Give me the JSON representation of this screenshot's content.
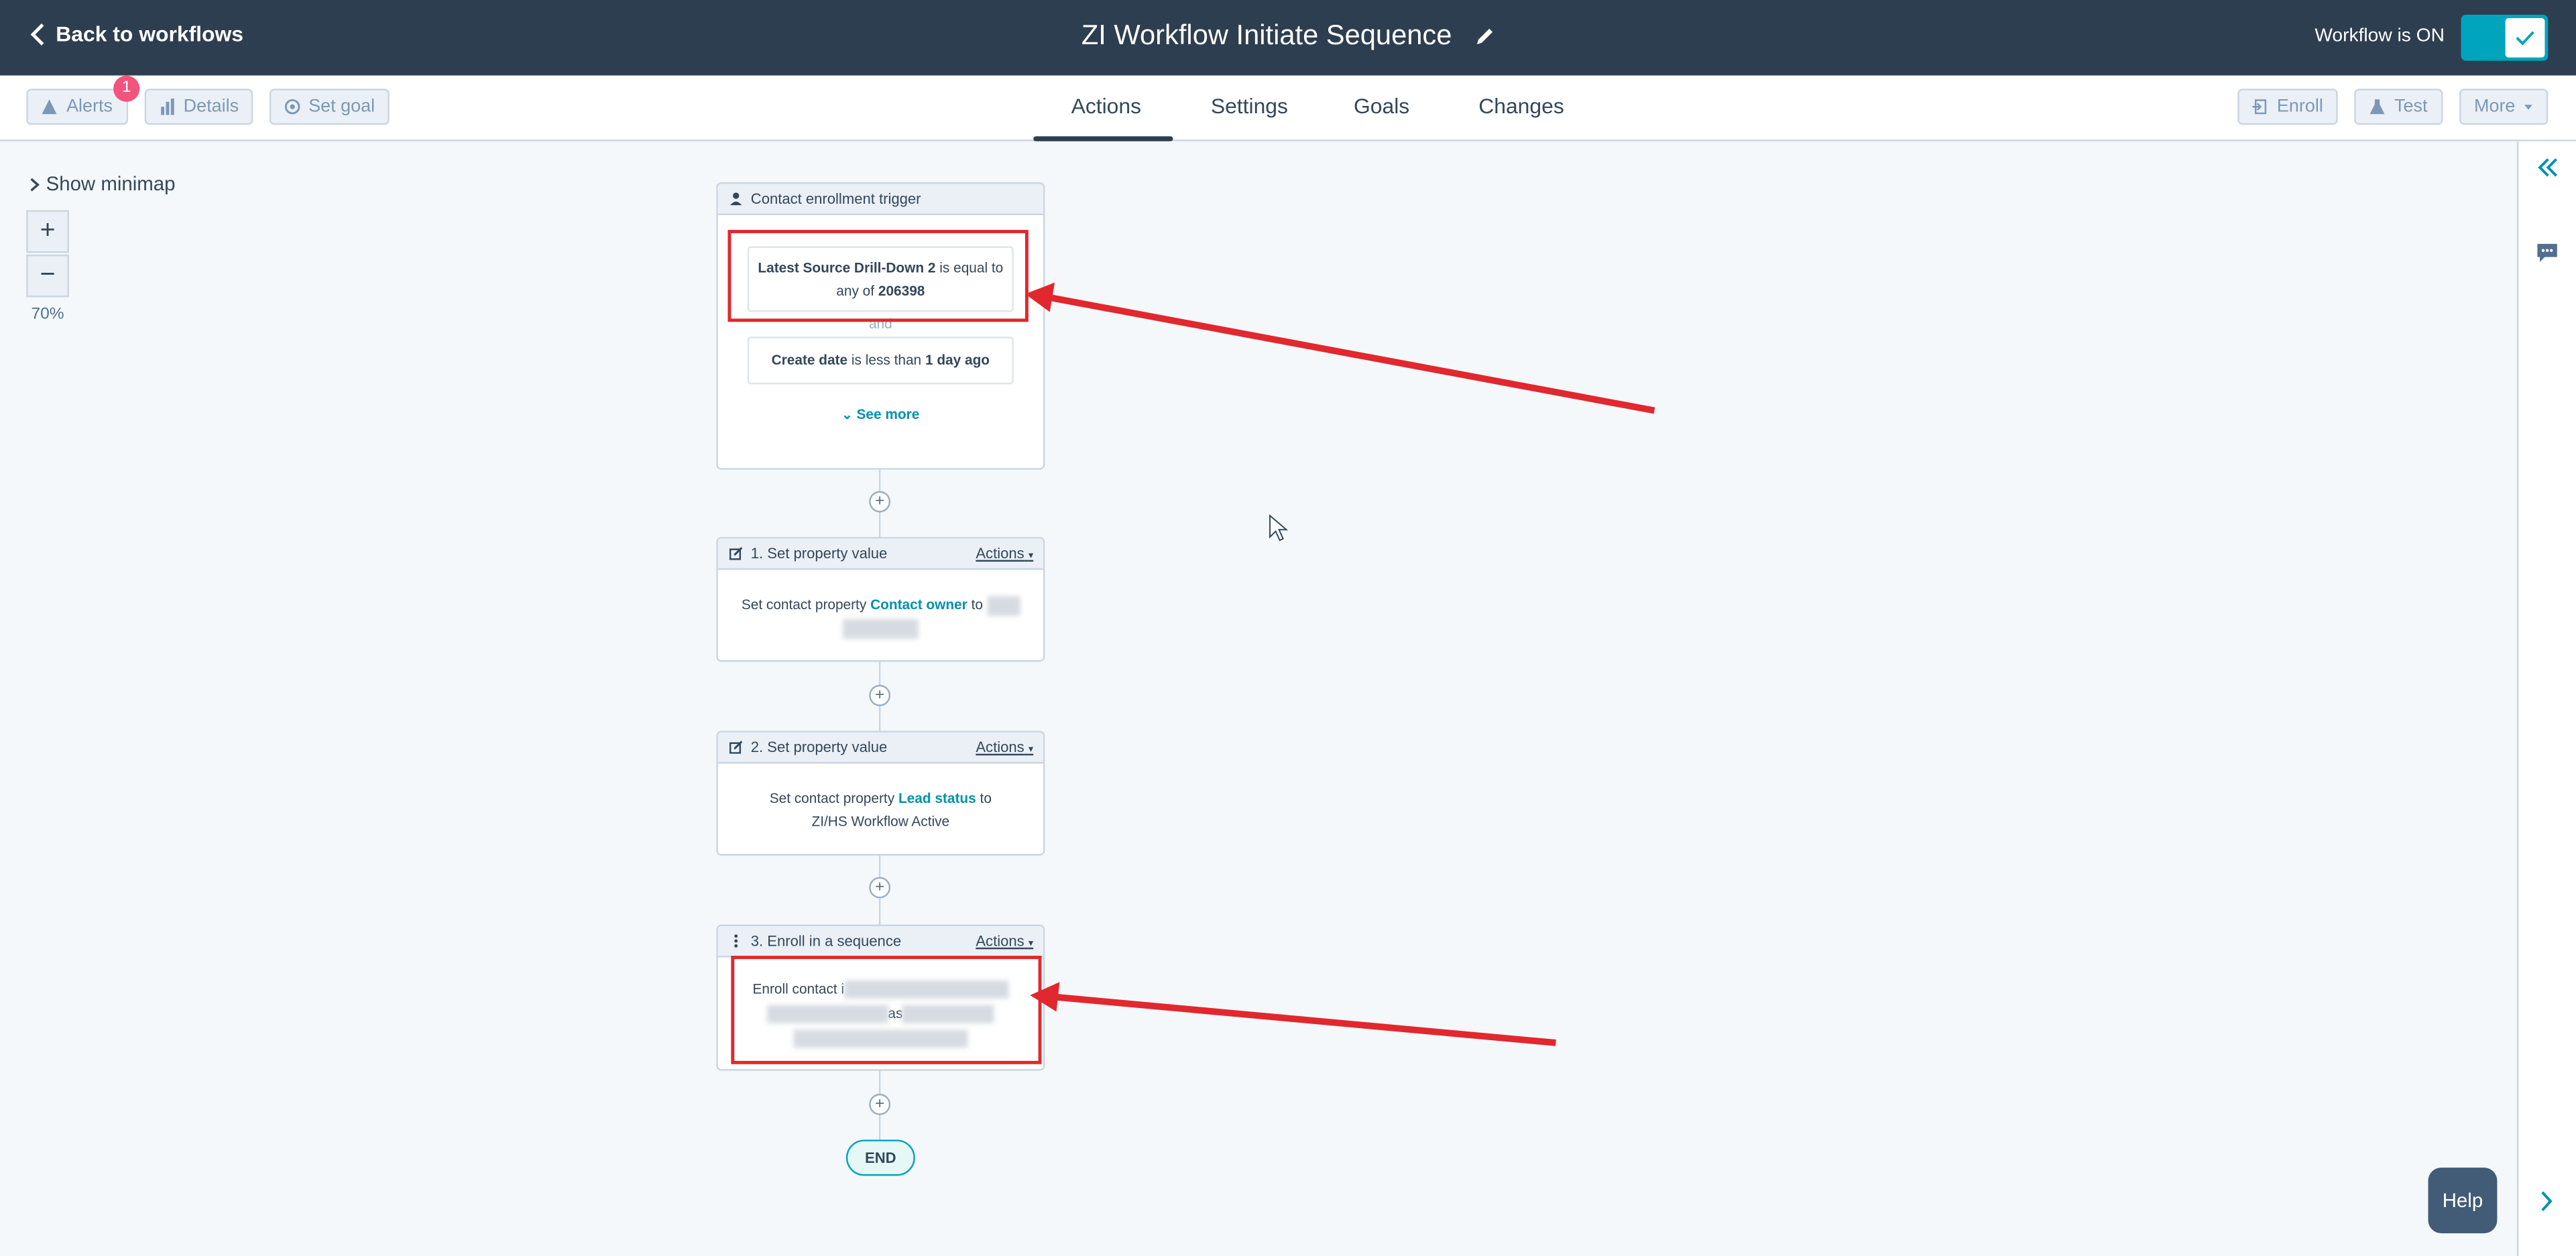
{
  "header": {
    "back_label": "Back to workflows",
    "workflow_title": "ZI Workflow Initiate Sequence",
    "status_label": "Workflow is ON"
  },
  "toolbar": {
    "alerts_label": "Alerts",
    "alerts_count": "1",
    "details_label": "Details",
    "set_goal_label": "Set goal",
    "enroll_label": "Enroll",
    "test_label": "Test",
    "more_label": "More"
  },
  "tabs": [
    {
      "label": "Actions",
      "active": true
    },
    {
      "label": "Settings",
      "active": false
    },
    {
      "label": "Goals",
      "active": false
    },
    {
      "label": "Changes",
      "active": false
    }
  ],
  "canvas": {
    "minimap_label": "Show minimap",
    "zoom_in": "+",
    "zoom_out": "−",
    "zoom_level": "70%"
  },
  "trigger": {
    "title": "Contact enrollment trigger",
    "filter1_prop": "Latest Source Drill-Down 2",
    "filter1_op": "is equal to",
    "filter1_op2": "any of",
    "filter1_value": "206398",
    "join": "and",
    "filter2_prop": "Create date",
    "filter2_op": "is less than",
    "filter2_value": "1 day ago",
    "see_more": "See more"
  },
  "actions": [
    {
      "title": "1. Set property value",
      "menu": "Actions",
      "text_pre": "Set contact property",
      "property": "Contact owner",
      "text_to": "to"
    },
    {
      "title": "2. Set property value",
      "menu": "Actions",
      "text_pre": "Set contact property",
      "property": "Lead status",
      "text_to": "to",
      "value": "ZI/HS Workflow Active"
    },
    {
      "title": "3. Enroll in a sequence",
      "menu": "Actions",
      "text_pre": "Enroll contact i",
      "text_as": "as"
    }
  ],
  "plus_symbol": "+",
  "end_label": "END",
  "help_label": "Help",
  "colors": {
    "header_bg": "#2d3e50",
    "toggle_on": "#00a4bd",
    "link_blue": "#0091ae",
    "annotation_red": "#e0282e",
    "badge_pink": "#f2547d"
  }
}
